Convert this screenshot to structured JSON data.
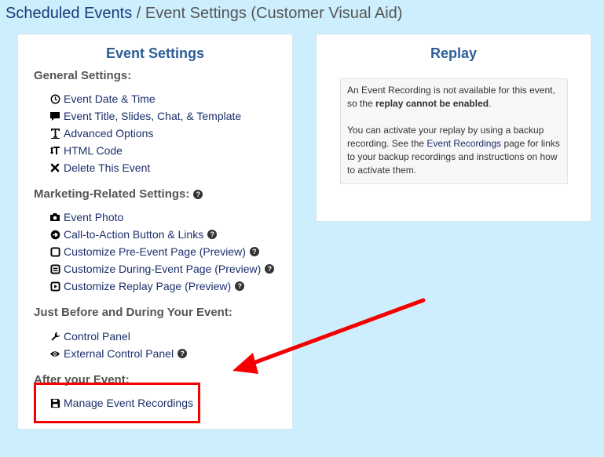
{
  "breadcrumb": {
    "root": "Scheduled Events",
    "separator": " / ",
    "current": "Event Settings (Customer Visual Aid)"
  },
  "left_panel": {
    "title": "Event Settings",
    "sections": [
      {
        "heading": "General Settings:",
        "items": [
          {
            "label": "Event Date & Time",
            "icon": "clock-icon"
          },
          {
            "label": "Event Title, Slides, Chat, & Template",
            "icon": "comment-icon"
          },
          {
            "label": "Advanced Options",
            "icon": "text-icon"
          },
          {
            "label": "HTML Code",
            "icon": "text-height-icon"
          },
          {
            "label": "Delete This Event",
            "icon": "times-icon"
          }
        ]
      },
      {
        "heading": "Marketing-Related Settings:",
        "items": [
          {
            "label": "Event Photo",
            "icon": "camera-icon"
          },
          {
            "label": "Call-to-Action Button & Links",
            "icon": "arrow-circle-right-icon"
          },
          {
            "label": "Customize Pre-Event Page (Preview)",
            "icon": "square-icon"
          },
          {
            "label": "Customize During-Event Page (Preview)",
            "icon": "list-square-icon"
          },
          {
            "label": "Customize Replay Page (Preview)",
            "icon": "play-square-icon"
          }
        ]
      },
      {
        "heading": "Just Before and During Your Event:",
        "items": [
          {
            "label": "Control Panel",
            "icon": "wrench-icon"
          },
          {
            "label": "External Control Panel",
            "icon": "eye-icon"
          }
        ]
      },
      {
        "heading": "After your Event:",
        "items": [
          {
            "label": "Manage Event Recordings",
            "icon": "floppy-disk-icon"
          }
        ]
      }
    ]
  },
  "right_panel": {
    "title": "Replay",
    "notice": {
      "line1_a": "An Event Recording is not available for this event, so the ",
      "line1_bold": "replay cannot be enabled",
      "line1_b": ".",
      "line2_a": "You can activate your replay by using a backup recording. See the ",
      "line2_link": "Event Recordings",
      "line2_b": " page for links to your backup recordings and instructions on how to activate them."
    }
  },
  "help_glyph": "?",
  "colors": {
    "background": "#cdeefd",
    "link": "#1b2f6b",
    "title": "#2b5e96",
    "annotation": "#f40000"
  }
}
